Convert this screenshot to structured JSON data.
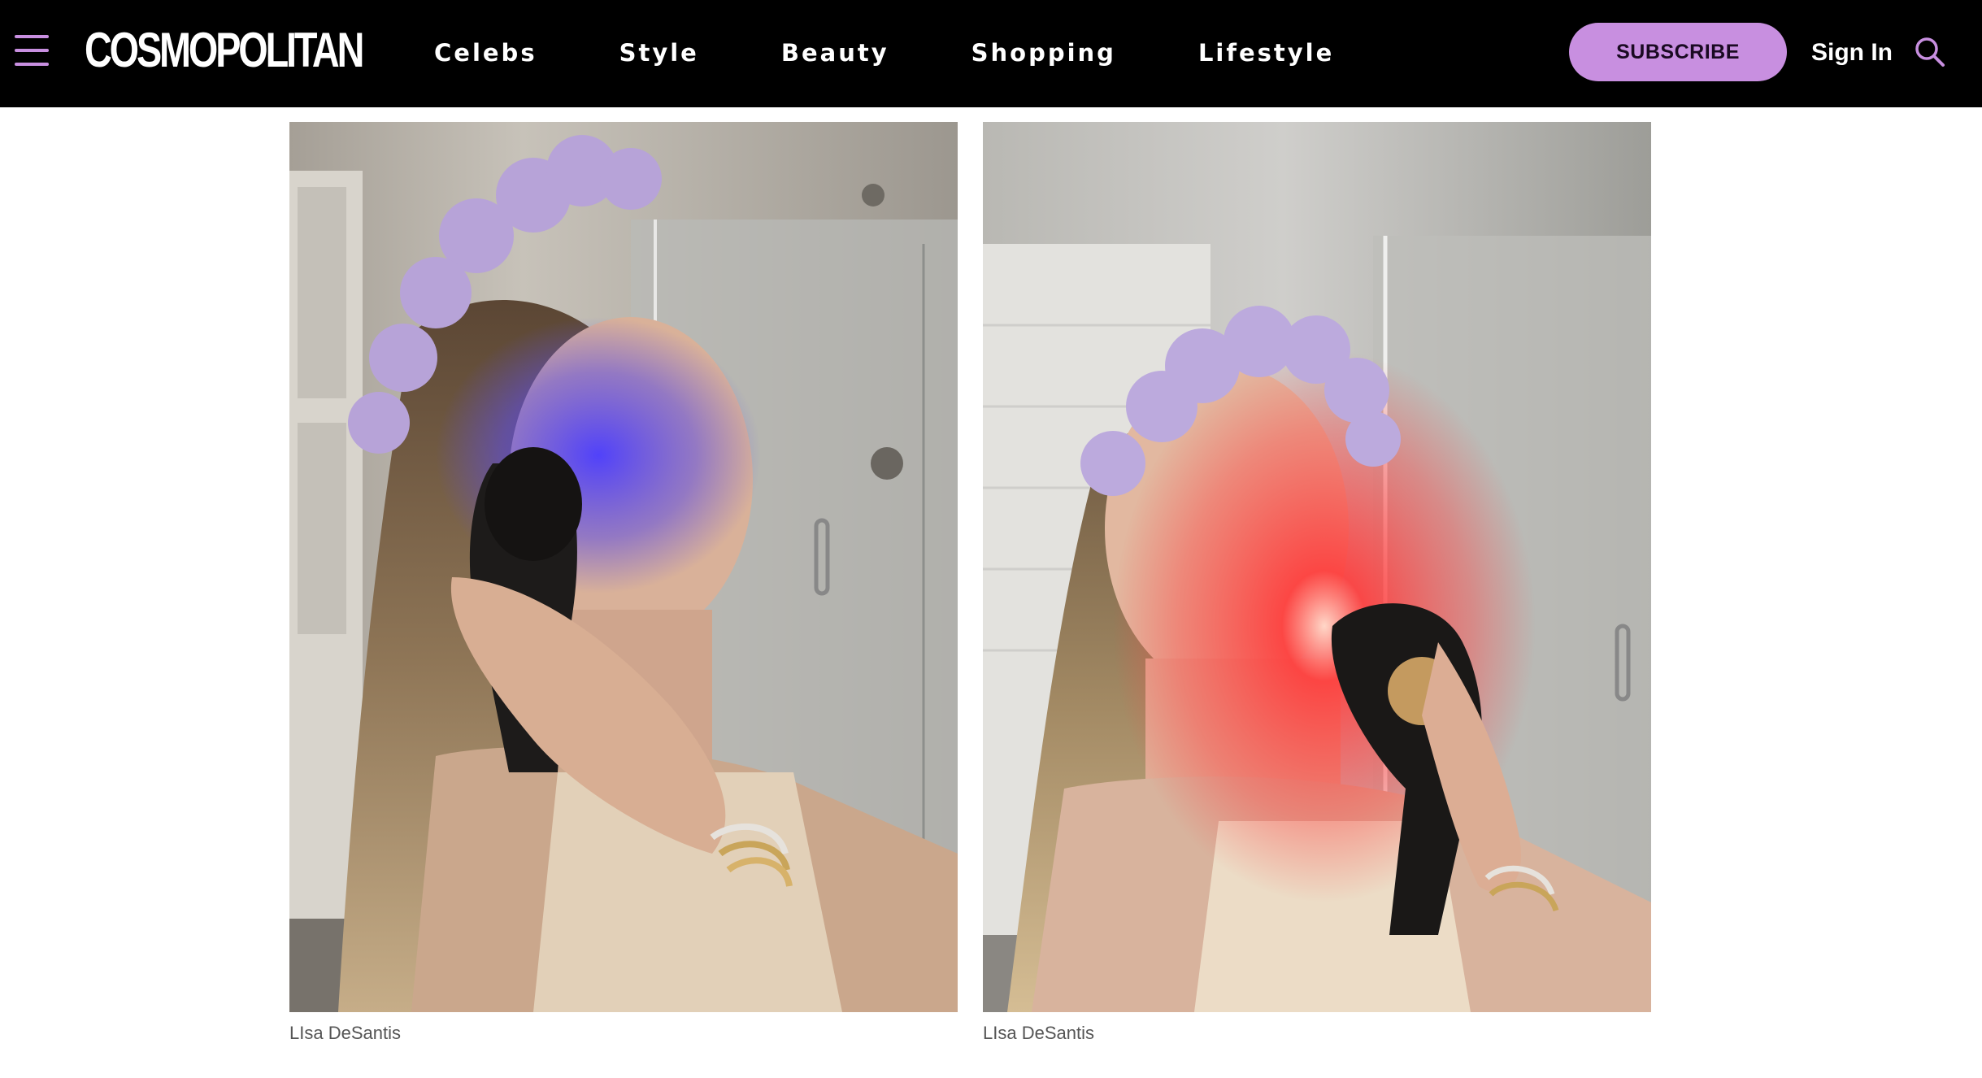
{
  "header": {
    "logo_text": "COSMOPOLITAN",
    "nav_items": [
      {
        "label": "Celebs"
      },
      {
        "label": "Style"
      },
      {
        "label": "Beauty"
      },
      {
        "label": "Shopping"
      },
      {
        "label": "Lifestyle"
      }
    ],
    "subscribe_label": "SUBSCRIBE",
    "signin_label": "Sign In",
    "menu_icon": "hamburger-menu-icon",
    "search_icon": "search-icon"
  },
  "colors": {
    "nav_bg": "#000000",
    "accent": "#c88fe0",
    "nav_text": "#ffffff"
  },
  "gallery": {
    "images": [
      {
        "alt": "Woman using a blue light therapy device on her cheek in a bathroom mirror",
        "credit": "LIsa DeSantis"
      },
      {
        "alt": "Woman using a red light therapy device on her jaw in a bathroom mirror",
        "credit": "LIsa DeSantis"
      }
    ]
  }
}
